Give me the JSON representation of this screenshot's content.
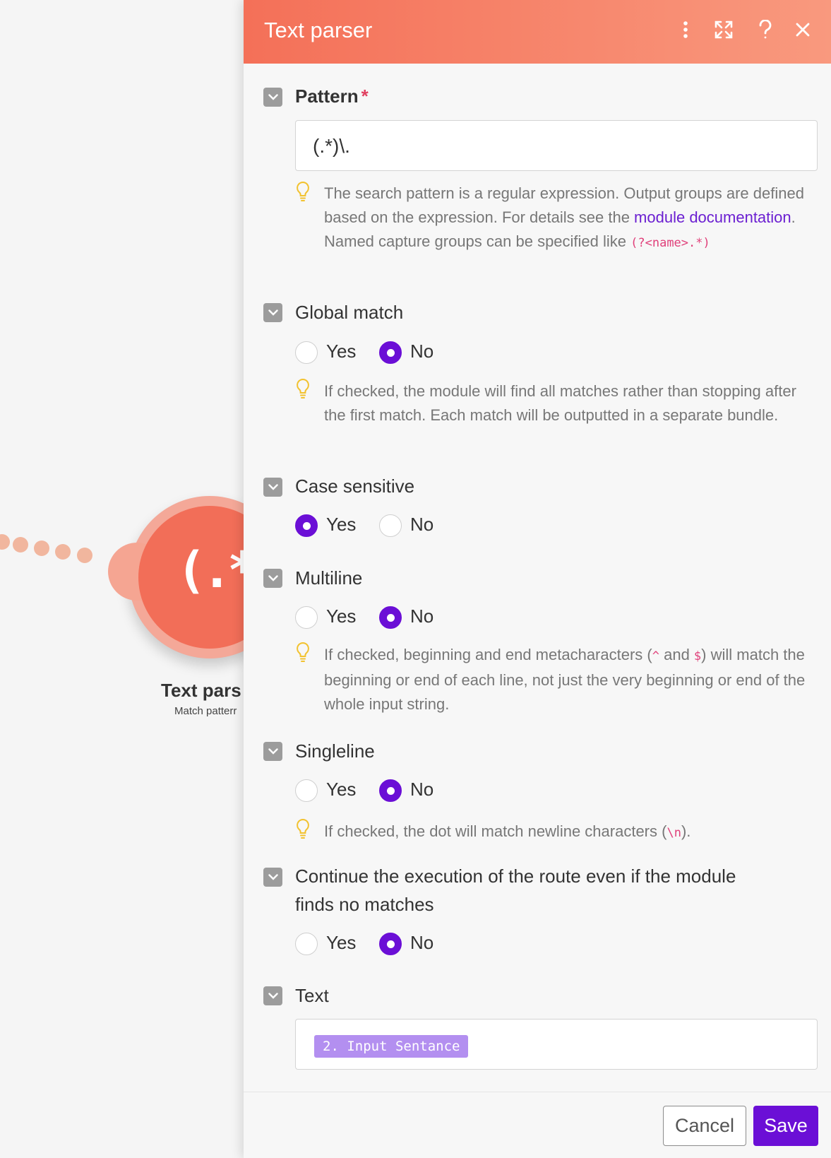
{
  "canvas": {
    "node": {
      "glyph": "(.*)",
      "title": "Text pars",
      "subtitle": "Match patterr"
    }
  },
  "panel": {
    "title": "Text parser",
    "header_icons": [
      "more-vertical-icon",
      "expand-icon",
      "help-icon",
      "close-icon"
    ],
    "pattern": {
      "label": "Pattern",
      "required_mark": "*",
      "value": "(.*)\\.",
      "hint_part1": "The search pattern is a regular expression. Output groups are defined based on the expression. For details see the ",
      "hint_link": "module documentation",
      "hint_part2": ".",
      "hint_line2": "Named capture groups can be specified like ",
      "hint_code": "(?<name>.*)"
    },
    "global_match": {
      "label": "Global match",
      "yes": "Yes",
      "no": "No",
      "selected": "No",
      "hint": "If checked, the module will find all matches rather than stopping after the first match. Each match will be outputted in a separate bundle."
    },
    "case_sensitive": {
      "label": "Case sensitive",
      "yes": "Yes",
      "no": "No",
      "selected": "Yes"
    },
    "multiline": {
      "label": "Multiline",
      "yes": "Yes",
      "no": "No",
      "selected": "No",
      "hint_part1": "If checked, beginning and end metacharacters (",
      "hint_code1": "^",
      "hint_part2": " and ",
      "hint_code2": "$",
      "hint_part3": ") will match the beginning or end of each line, not just the very beginning or end of the whole input string."
    },
    "singleline": {
      "label": "Singleline",
      "yes": "Yes",
      "no": "No",
      "selected": "No",
      "hint_part1": "If checked, the dot will match newline characters (",
      "hint_code": "\\n",
      "hint_part2": ")."
    },
    "continue_execution": {
      "label_line1": "Continue the execution of the route even if the module",
      "label_line2": "finds no matches",
      "yes": "Yes",
      "no": "No",
      "selected": "No"
    },
    "text": {
      "label": "Text",
      "pill": "2. Input Sentance"
    },
    "footer": {
      "cancel": "Cancel",
      "save": "Save"
    }
  },
  "colors": {
    "header_start": "#f47058",
    "header_end": "#f9997e",
    "accent_purple": "#6b0fd6",
    "link_purple": "#6b1fd1",
    "code_pink": "#e0407a",
    "hint_bulb": "#f2c230",
    "pill_bg": "#b38ff0"
  }
}
